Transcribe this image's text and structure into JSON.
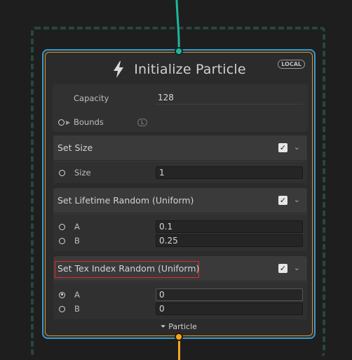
{
  "node": {
    "title": "Initialize Particle",
    "badge": "LOCAL",
    "icon": "lightning-bolt-icon"
  },
  "properties": {
    "capacity_label": "Capacity",
    "capacity_value": "128",
    "bounds_label": "Bounds",
    "bounds_space": "L"
  },
  "blocks": [
    {
      "title": "Set Size",
      "enabled": true,
      "fields": [
        {
          "label": "Size",
          "value": "1"
        }
      ]
    },
    {
      "title": "Set Lifetime Random (Uniform)",
      "enabled": true,
      "fields": [
        {
          "label": "A",
          "value": "0.1"
        },
        {
          "label": "B",
          "value": "0.25"
        }
      ]
    },
    {
      "title": "Set Tex Index Random (Uniform)",
      "enabled": true,
      "fields": [
        {
          "label": "A",
          "value": "0"
        },
        {
          "label": "B",
          "value": "0"
        }
      ]
    }
  ],
  "output": {
    "label": "Particle"
  },
  "colors": {
    "flow_in": "#1db89a",
    "flow_out": "#f5a623",
    "context_border": "#3a97cc",
    "highlight": "#e02b2b"
  }
}
